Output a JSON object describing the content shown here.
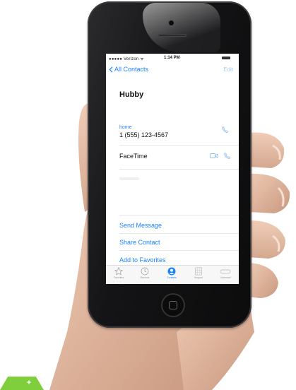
{
  "status_bar": {
    "carrier": "●●●●● Verizon ᯤ",
    "time": "1:14 PM"
  },
  "nav": {
    "back_label": "All Contacts",
    "edit_label": "Edit"
  },
  "contact": {
    "name": "Hubby",
    "phone_label": "home",
    "phone_number": "1 (555) 123-4567",
    "facetime_label": "FaceTime"
  },
  "actions": {
    "send_message": "Send Message",
    "share_contact": "Share Contact",
    "add_to_favorites": "Add to Favorites"
  },
  "tabs": [
    {
      "label": "Favorites",
      "icon": "star-icon",
      "active": false
    },
    {
      "label": "Recents",
      "icon": "clock-icon",
      "active": false
    },
    {
      "label": "Contacts",
      "icon": "person-icon",
      "active": true
    },
    {
      "label": "Keypad",
      "icon": "keypad-icon",
      "active": false
    },
    {
      "label": "Voicemail",
      "icon": "voicemail-icon",
      "active": false
    }
  ],
  "colors": {
    "accent": "#1a82fb",
    "corner_tab": "#7fcf3c",
    "skin": "#e2b9a0"
  }
}
